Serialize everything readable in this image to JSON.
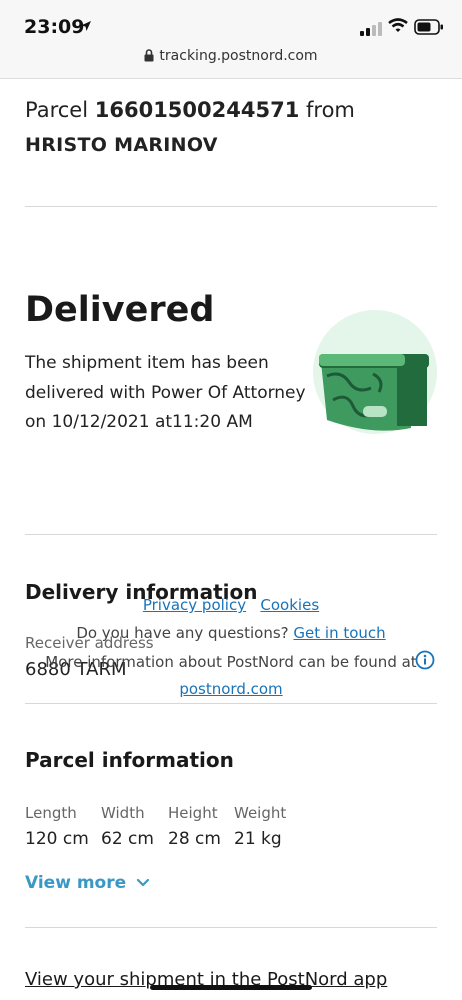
{
  "status_bar": {
    "time": "23:09"
  },
  "browser": {
    "url": "tracking.postnord.com"
  },
  "parcel": {
    "prefix": "Parcel",
    "number": "16601500244571",
    "from_word": "from",
    "sender": "HRISTO MARINOV"
  },
  "status": {
    "title": "Delivered",
    "description": "The shipment item has been delivered with Power Of Attorney on 10/12/2021 at11:20 AM"
  },
  "delivery_info": {
    "heading": "Delivery information",
    "receiver_label": "Receiver address",
    "receiver_value": "6880 TARM"
  },
  "footer_overlay": {
    "privacy": "Privacy policy",
    "cookies": "Cookies",
    "question": "Do you have any questions?",
    "get_in_touch": "Get in touch",
    "more_info": "More information about PostNord can be found at",
    "site": "postnord.com"
  },
  "parcel_info": {
    "heading": "Parcel information",
    "columns": [
      {
        "label": "Length",
        "value": "120 cm"
      },
      {
        "label": "Width",
        "value": "62 cm"
      },
      {
        "label": "Height",
        "value": "28 cm"
      },
      {
        "label": "Weight",
        "value": "21 kg"
      }
    ],
    "view_more": "View more"
  },
  "app_link": "View your shipment in the PostNord app",
  "colors": {
    "accent_link": "#3a98c4",
    "footer_link": "#1a73b8",
    "illus_bg": "#e4f5e9",
    "box_green": "#3f9a5f",
    "box_dark": "#216b3d"
  },
  "icons": [
    "location-arrow-icon",
    "cellular-signal-icon",
    "wifi-icon",
    "battery-icon",
    "lock-icon",
    "info-icon",
    "chevron-down-icon",
    "delivered-box-illustration"
  ]
}
